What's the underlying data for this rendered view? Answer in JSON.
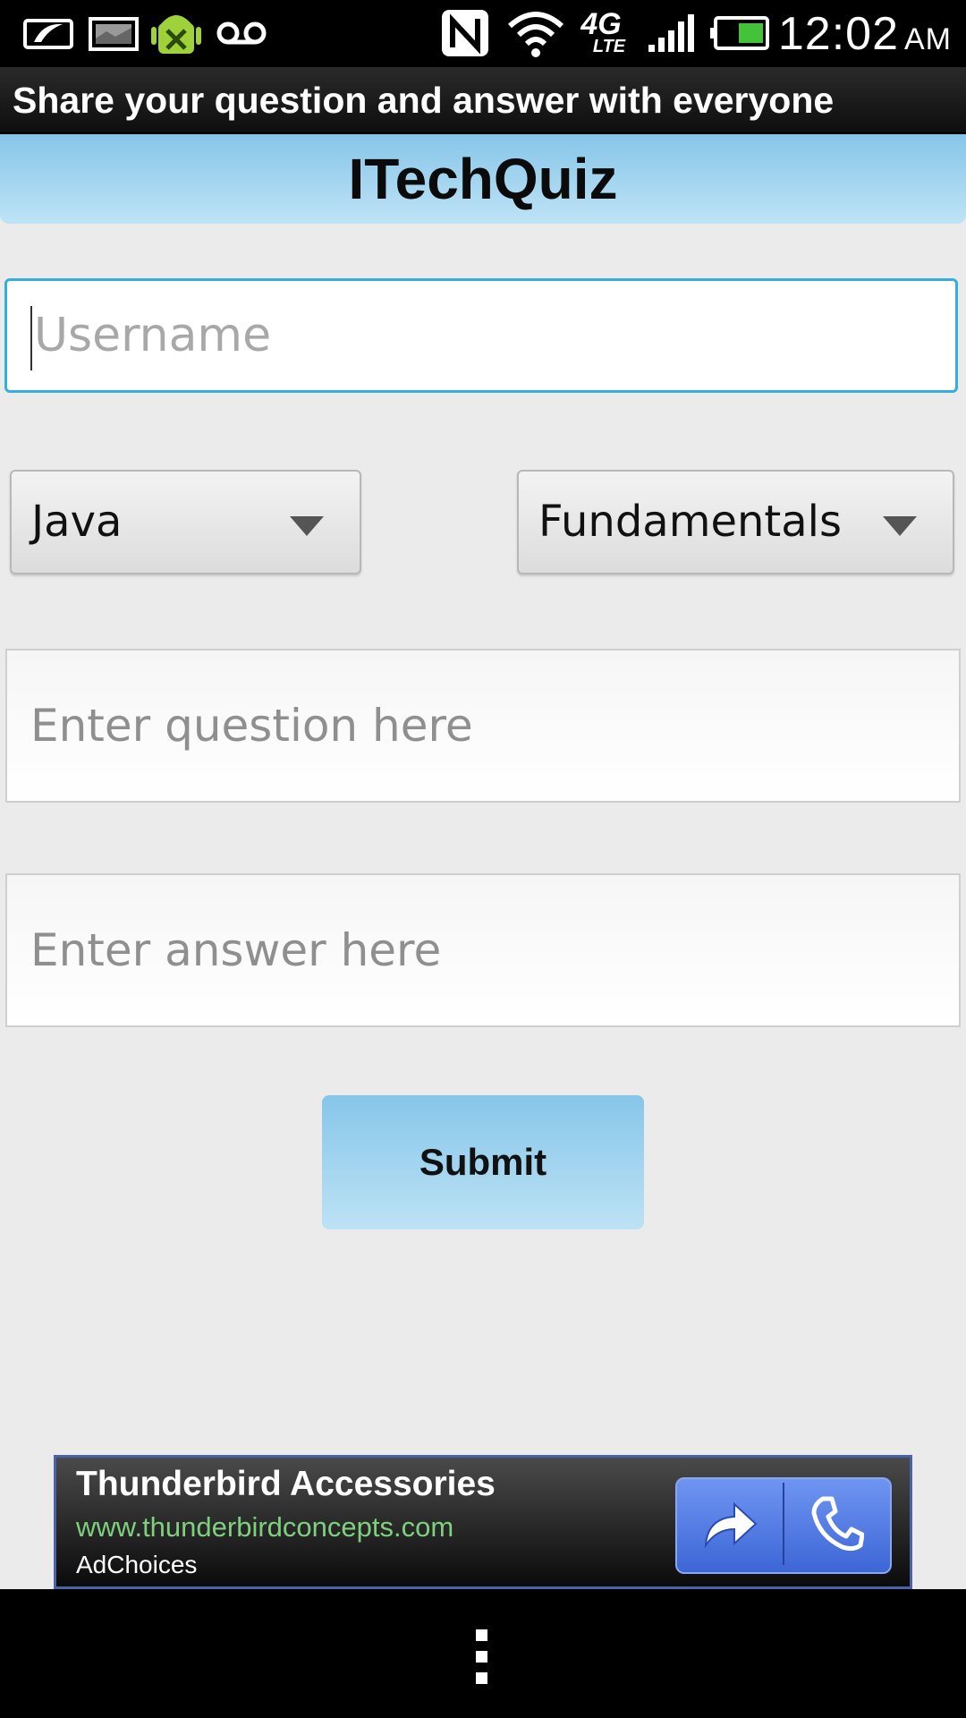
{
  "status_bar": {
    "time": "12:02",
    "ampm": "AM",
    "network_label": "4G",
    "network_sub": "LTE",
    "icons": [
      "whatsapp-like-icon",
      "image-icon",
      "android-debug-icon",
      "voicemail-icon",
      "nfc-icon",
      "wifi-icon",
      "4g-lte-icon",
      "signal-icon",
      "battery-icon"
    ]
  },
  "title_bar": {
    "text": "Share your question and answer with everyone"
  },
  "header": {
    "title": "ITechQuiz"
  },
  "form": {
    "username_placeholder": "Username",
    "language_spinner": "Java",
    "topic_spinner": "Fundamentals",
    "question_placeholder": "Enter question here",
    "answer_placeholder": "Enter answer here",
    "submit_label": "Submit"
  },
  "ad": {
    "title": "Thunderbird Accessories",
    "url": "www.thunderbirdconcepts.com",
    "choices": "AdChoices"
  },
  "colors": {
    "header_blue": "#86c6e9",
    "focus_border": "#34aedc",
    "ad_url_green": "#7ed07e",
    "ad_button_blue": "#4a74e0"
  }
}
